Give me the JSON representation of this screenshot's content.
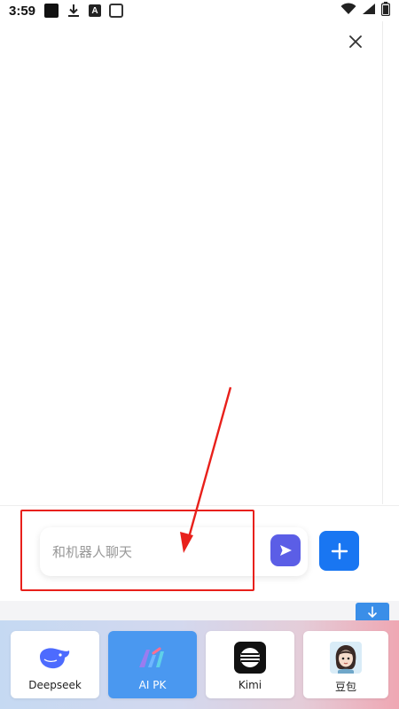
{
  "status_bar": {
    "time": "3:59",
    "letter_icon": "A",
    "icons_left": [
      "black-square-icon",
      "download-icon",
      "letter-a-icon",
      "white-square-icon"
    ],
    "icons_right": [
      "wifi-icon",
      "signal-icon",
      "battery-icon"
    ]
  },
  "header": {
    "close_icon": "close-icon"
  },
  "composer": {
    "placeholder": "和机器人聊天",
    "send_icon": "send-icon",
    "add_icon": "plus-icon"
  },
  "scroll": {
    "icon": "arrow-down-icon"
  },
  "bots": [
    {
      "label": "Deepseek",
      "icon": "deepseek-whale-icon",
      "active": false
    },
    {
      "label": "AI PK",
      "icon": "ai-pk-icon",
      "active": true
    },
    {
      "label": "Kimi",
      "icon": "kimi-icon",
      "active": false
    },
    {
      "label": "豆包",
      "icon": "doubao-avatar-icon",
      "active": false
    }
  ],
  "colors": {
    "annotation": "#e8201b",
    "send_button": "#5b5ee6",
    "add_button": "#1976f2",
    "active_card": "#4a98f0",
    "scroll_button": "#3a8ee8"
  }
}
